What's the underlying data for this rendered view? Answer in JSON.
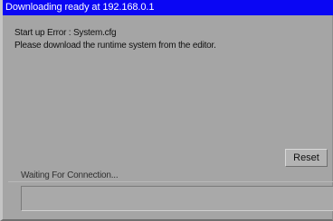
{
  "window": {
    "title": "Downloading ready  at 192.168.0.1"
  },
  "message": {
    "line1": "Start up Error : System.cfg",
    "line2": "Please download the runtime system from the editor."
  },
  "controls": {
    "reset_label": "Reset"
  },
  "status": {
    "text": "Waiting For Connection..."
  },
  "colors": {
    "titlebar": "#0a06f4",
    "background": "#a5a5a5"
  }
}
